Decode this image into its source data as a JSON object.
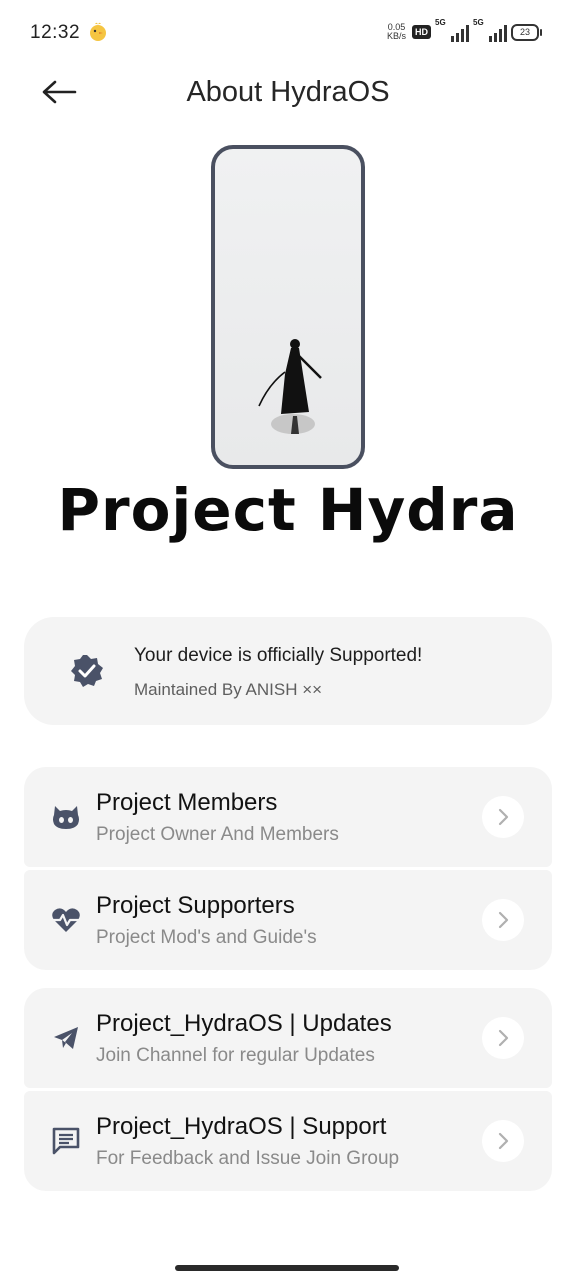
{
  "status_bar": {
    "time": "12:32",
    "net_speed_value": "0.05",
    "net_speed_unit": "KB/s",
    "hd_label": "HD",
    "signal1_label": "5G",
    "signal2_label": "5G",
    "battery": "23"
  },
  "header": {
    "title": "About HydraOS",
    "back_icon": "arrow-left-icon"
  },
  "brand": {
    "name": "Project Hydra"
  },
  "support_card": {
    "icon": "verified-badge-icon",
    "title": "Your device is officially Supported!",
    "maintainer": "Maintained By ANISH ××"
  },
  "groups": [
    {
      "rows": [
        {
          "icon": "github-icon",
          "title": "Project Members",
          "subtitle": "Project Owner And Members"
        },
        {
          "icon": "heartbeat-icon",
          "title": "Project Supporters",
          "subtitle": "Project Mod's and Guide's"
        }
      ]
    },
    {
      "rows": [
        {
          "icon": "telegram-icon",
          "title": "Project_HydraOS | Updates",
          "subtitle": "Join Channel for regular Updates"
        },
        {
          "icon": "chat-icon",
          "title": "Project_HydraOS | Support",
          "subtitle": "For Feedback and Issue Join Group"
        }
      ]
    }
  ],
  "colors": {
    "card_bg": "#f4f4f4",
    "icon_color": "#4a5268",
    "title_text": "#121212",
    "subtitle_text": "#8a8a8a"
  }
}
